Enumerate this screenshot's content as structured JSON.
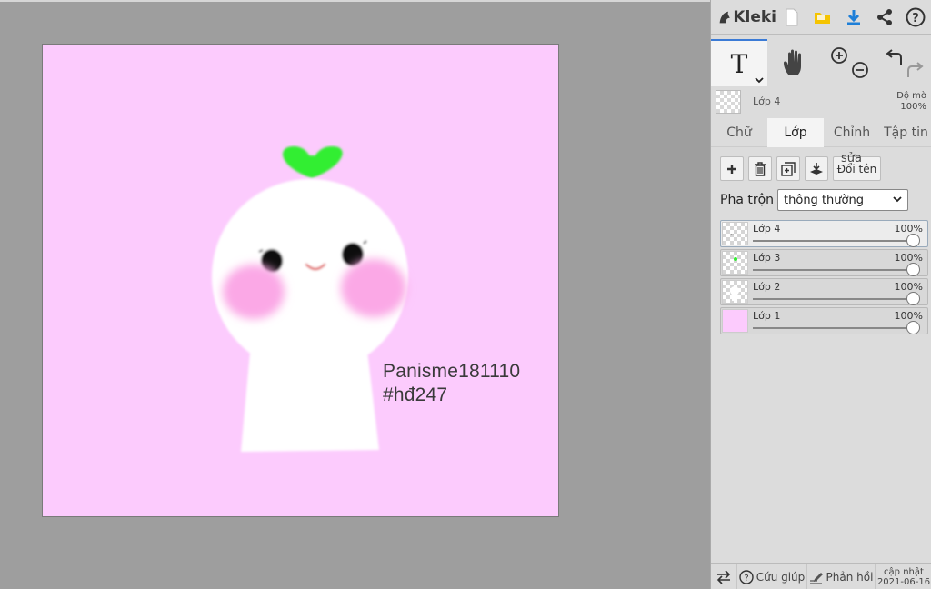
{
  "app": {
    "logo_text": "Kleki"
  },
  "canvas": {
    "bg_color": "#fccbfd",
    "text_line_1": "Panisme181110",
    "text_line_2": "#hđ247"
  },
  "preview": {
    "layer_name": "Lớp 4",
    "opacity_label": "Độ mờ",
    "opacity_value": "100%"
  },
  "tabs": [
    {
      "label": "Chữ",
      "active": false
    },
    {
      "label": "Lớp",
      "active": true
    },
    {
      "label": "Chỉnh",
      "active": false
    },
    {
      "label": "Tập tin",
      "active": false
    }
  ],
  "layer_actions": {
    "rename_label": "Đổi tên",
    "edit_overlay": "sửa"
  },
  "blend": {
    "label": "Pha trộn",
    "value": "thông thường"
  },
  "layers": [
    {
      "name": "Lớp 4",
      "opacity": "100%",
      "active": true
    },
    {
      "name": "Lớp 3",
      "opacity": "100%",
      "active": false
    },
    {
      "name": "Lớp 2",
      "opacity": "100%",
      "active": false
    },
    {
      "name": "Lớp 1",
      "opacity": "100%",
      "active": false
    }
  ],
  "bottom": {
    "help_label": "Cứu giúp",
    "feedback_label": "Phản hồi",
    "update_label": "cập nhật",
    "update_date": "2021-06-16"
  },
  "colors": {
    "accent": "#3b7bd6",
    "canvas_pink": "#fccbfd",
    "sprout_green": "#33ee33",
    "blush_pink": "#fba8e6"
  }
}
